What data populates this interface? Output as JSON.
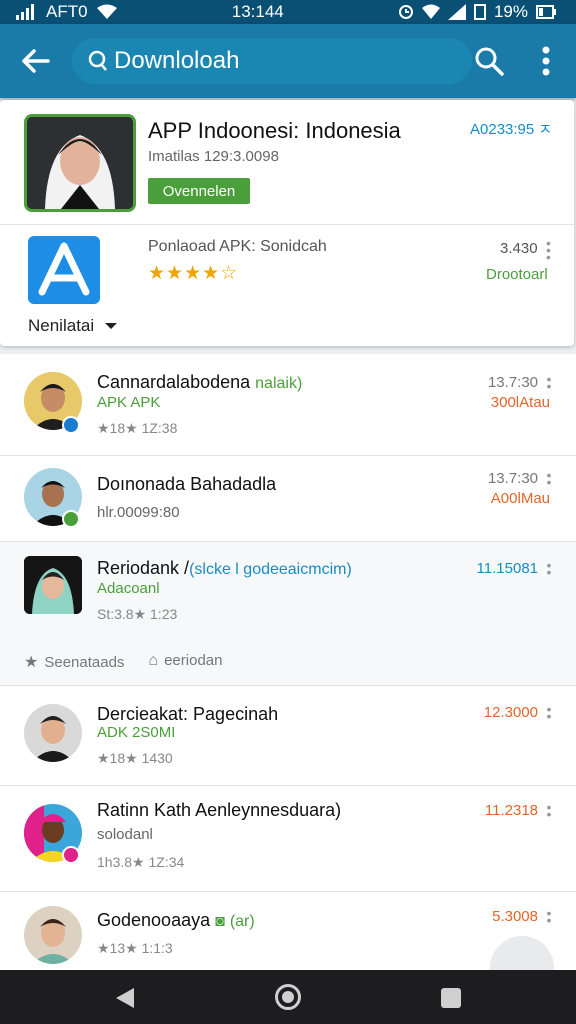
{
  "status_bar": {
    "carrier": "AFT0",
    "time": "13:144",
    "battery": "19%"
  },
  "app_bar": {
    "search_text": "Downloloah"
  },
  "featured": {
    "title": "APP Indoonesi: Indonesia",
    "id": "A0233:95 ㅈ",
    "subtitle": "Imatilas 129:3.0098",
    "button": "Ovennelen"
  },
  "store": {
    "name": "Ponlaoad APK: Sonidcah",
    "rating_stars": "★★★★☆",
    "number": "3.430",
    "download_label": "Drootoarl",
    "filter_label": "Nenilatai"
  },
  "list": [
    {
      "title": "Cannardalabodena",
      "tag": "nalaik)",
      "subtitle": "APK APK",
      "meta": "★18★ 1Z:38",
      "number": "13.7:30",
      "download": "300lAtau"
    },
    {
      "title": "Doınonada Bahadadlа",
      "subtitle": "hlr.00099:80",
      "number": "13.7:30",
      "download": "A00lMau"
    },
    {
      "title": "Reriodank /",
      "tag": "(slcke l godeeaicmcim)",
      "subtitle": "Adacoanl",
      "meta": "St:3.8★ 1:23",
      "number": "11.15081",
      "actions": [
        "Seenataads",
        "eeriodan"
      ]
    },
    {
      "title": "Dercieakat: Pagecinah",
      "subtitle": "ADK 2S0MI",
      "meta": "★18★ 1430",
      "number": "12.3000"
    },
    {
      "title": "Ratinn Kath Aenleynnesduara)",
      "subtitle": "solodanl",
      "meta": "1h3.8★ 1Z:34",
      "number": "11.2318"
    },
    {
      "title": "Godenooaaya",
      "tag": "(ar)",
      "meta": "★13★ 1:1:3",
      "number": "5.3008"
    }
  ]
}
